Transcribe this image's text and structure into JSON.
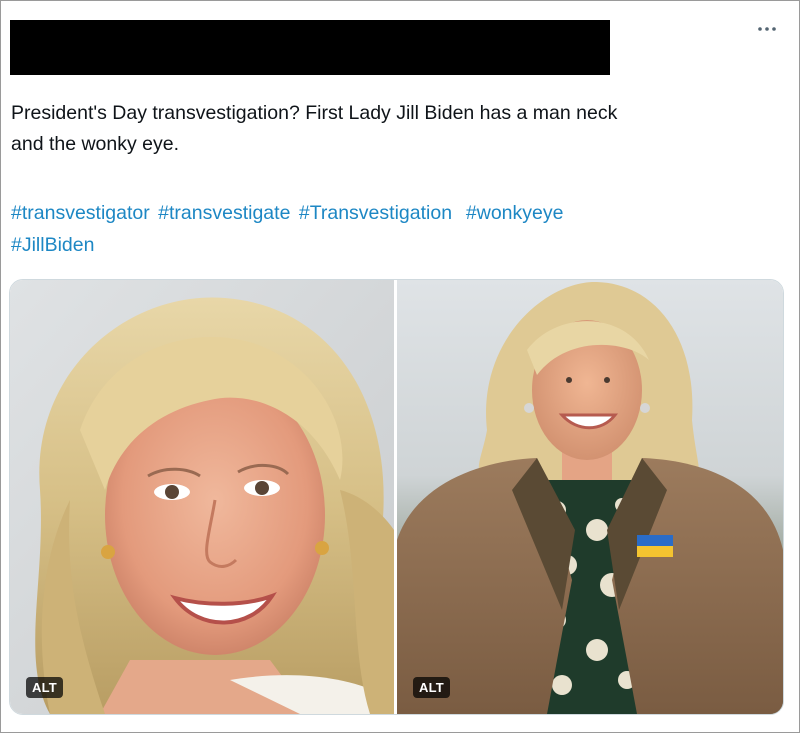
{
  "post": {
    "text": "President's Day transvestigation? First Lady Jill Biden has a man neck\nand the wonky eye.",
    "hashtags": [
      "#transvestigator",
      "#transvestigate",
      "#Transvestigation",
      "#wonkyeye",
      "#JillBiden"
    ],
    "more_icon": "more-horizontal-icon"
  },
  "media": {
    "images": [
      {
        "alt_badge": "ALT"
      },
      {
        "alt_badge": "ALT"
      }
    ]
  },
  "colors": {
    "text": "#0f1419",
    "hashtag": "#1d87c4",
    "redaction": "#000000",
    "border": "#9a9a9a"
  }
}
